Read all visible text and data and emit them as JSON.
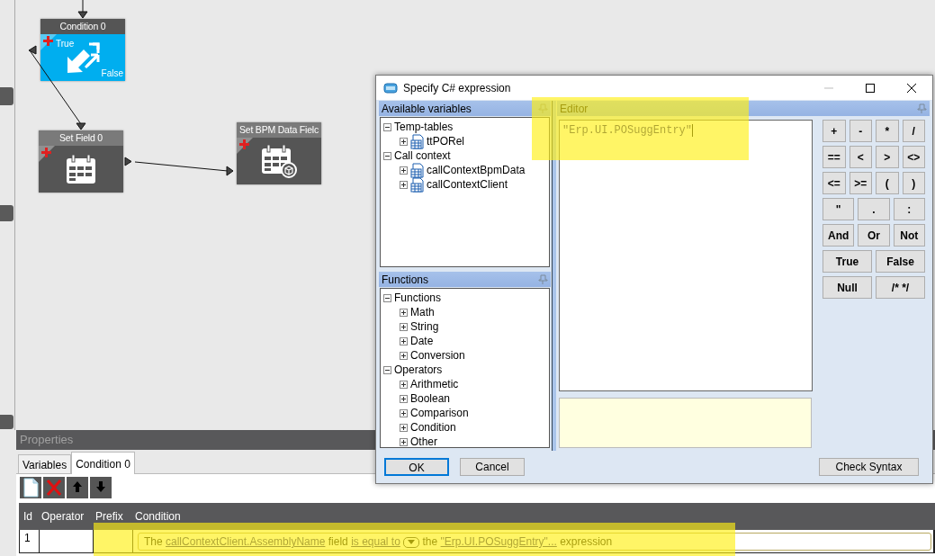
{
  "canvas": {
    "nodes": [
      {
        "kind": "condition",
        "title": "Condition 0",
        "true_label": "True",
        "false_label": "False"
      },
      {
        "kind": "set_field",
        "title": "Set Field 0"
      },
      {
        "kind": "set_bpm",
        "title": "Set BPM Data Fielc"
      }
    ]
  },
  "properties": {
    "title": "Properties",
    "tabs": [
      {
        "label": "Variables",
        "selected": false
      },
      {
        "label": "Condition 0",
        "selected": true
      }
    ],
    "grid": {
      "columns": [
        "Id",
        "Operator",
        "Prefix",
        "Condition"
      ],
      "rows": [
        {
          "id": "1",
          "condition": [
            {
              "kind": "text",
              "text": "The"
            },
            {
              "kind": "link",
              "text": "callContextClient.AssemblyName"
            },
            {
              "kind": "text",
              "text": "field"
            },
            {
              "kind": "link",
              "text": "is equal to"
            },
            {
              "kind": "dropdown"
            },
            {
              "kind": "text",
              "text": "the"
            },
            {
              "kind": "link",
              "text": "\"Erp.UI.POSuggEntry\"..."
            },
            {
              "kind": "text",
              "text": "expression"
            }
          ]
        }
      ]
    }
  },
  "dialog": {
    "title": "Specify C# expression",
    "variables_panel": {
      "title": "Available variables",
      "tree": [
        {
          "label": "Temp-tables",
          "expanded": true,
          "children": [
            {
              "label": "ttPORel",
              "kind": "table",
              "expanded": false
            }
          ]
        },
        {
          "label": "Call context",
          "expanded": true,
          "children": [
            {
              "label": "callContextBpmData",
              "kind": "table",
              "expanded": false
            },
            {
              "label": "callContextClient",
              "kind": "table",
              "expanded": false
            }
          ]
        }
      ]
    },
    "functions_panel": {
      "title": "Functions",
      "tree": [
        {
          "label": "Functions",
          "expanded": true,
          "children": [
            {
              "label": "Math",
              "expanded": false
            },
            {
              "label": "String",
              "expanded": false
            },
            {
              "label": "Date",
              "expanded": false
            },
            {
              "label": "Conversion",
              "expanded": false
            }
          ]
        },
        {
          "label": "Operators",
          "expanded": true,
          "children": [
            {
              "label": "Arithmetic",
              "expanded": false
            },
            {
              "label": "Boolean",
              "expanded": false
            },
            {
              "label": "Comparison",
              "expanded": false
            },
            {
              "label": "Condition",
              "expanded": false
            },
            {
              "label": "Other",
              "expanded": false
            }
          ]
        }
      ]
    },
    "editor": {
      "title": "Editor",
      "value": "\"Erp.UI.POSuggEntry\""
    },
    "operator_buttons": [
      [
        "+",
        "-",
        "*",
        "/"
      ],
      [
        "==",
        "<",
        ">",
        "<>"
      ],
      [
        "<=",
        ">=",
        "(",
        ")"
      ],
      [
        "\"",
        ".",
        ":"
      ],
      [
        "And",
        "Or",
        "Not"
      ],
      [
        "True",
        "False"
      ],
      [
        "Null",
        "/* */"
      ]
    ],
    "buttons": [
      {
        "label": "OK",
        "default": true
      },
      {
        "label": "Cancel",
        "default": false
      }
    ],
    "check_syntax": "Check Syntax"
  }
}
